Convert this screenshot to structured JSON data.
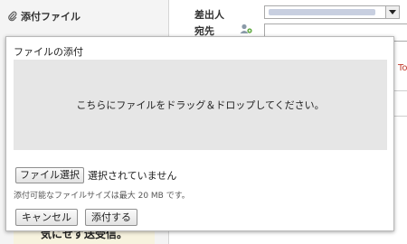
{
  "compose": {
    "attach_label": "添付ファイル",
    "sender_label": "差出人",
    "to_label": "宛先",
    "bg_to_text": "To",
    "promo_text": "気にせず送受信。"
  },
  "dialog": {
    "title": "ファイルの添付",
    "dropzone_text": "こちらにファイルをドラッグ＆ドロップしてください。",
    "choose_file_label": "ファイル選択",
    "file_status": "選択されていません",
    "size_note": "添付可能なファイルサイズは最大 20 MB です。",
    "cancel_label": "キャンセル",
    "attach_label": "添付する"
  },
  "icons": {
    "attach": "paperclip-icon",
    "address_book": "address-book-icon",
    "dropdown": "chevron-down-icon"
  },
  "colors": {
    "promo": "#1f7fd0",
    "dropzone": "#e6e6e6",
    "to_text": "#c0392b"
  }
}
